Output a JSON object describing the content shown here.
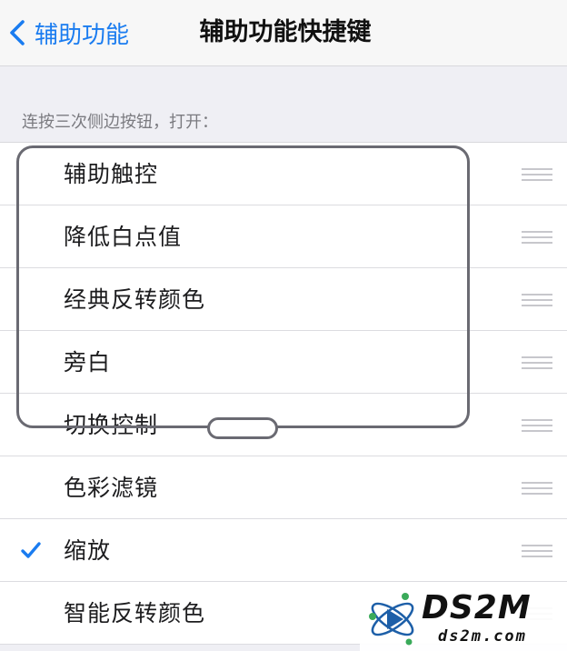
{
  "navbar": {
    "back_label": "辅助功能",
    "title": "辅助功能快捷键"
  },
  "section": {
    "header": "连按三次侧边按钮，打开："
  },
  "items": [
    {
      "label": "辅助触控",
      "checked": false
    },
    {
      "label": "降低白点值",
      "checked": false
    },
    {
      "label": "经典反转颜色",
      "checked": false
    },
    {
      "label": "旁白",
      "checked": false
    },
    {
      "label": "切换控制",
      "checked": false
    },
    {
      "label": "色彩滤镜",
      "checked": false
    },
    {
      "label": "缩放",
      "checked": true
    },
    {
      "label": "智能反转颜色",
      "checked": false
    }
  ],
  "watermark": {
    "title": "DS2M",
    "subtitle": "ds2m.com"
  },
  "colors": {
    "accent": "#1a7cf0",
    "background": "#efeff4",
    "separator": "#dcdce0",
    "outline": "#6a6a72"
  },
  "icons": {
    "back": "chevron-left-icon",
    "check": "checkmark-icon",
    "reorder": "reorder-handle-icon"
  }
}
